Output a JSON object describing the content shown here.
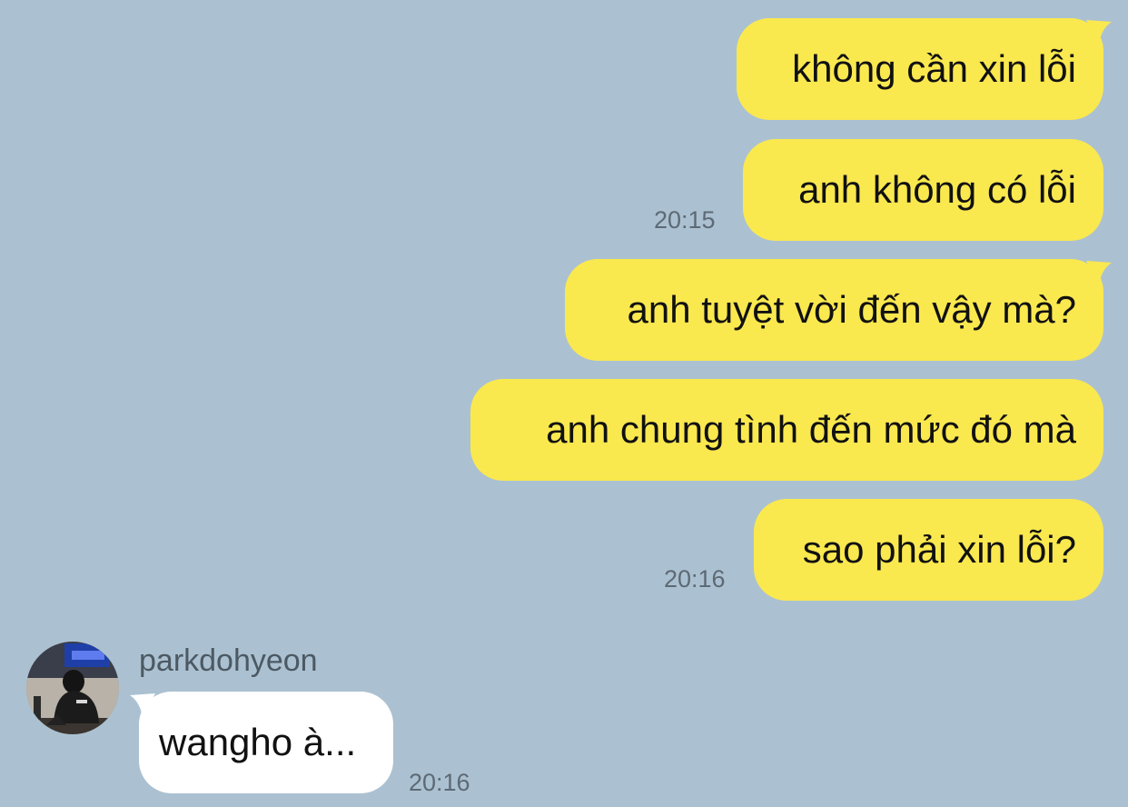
{
  "conversation": {
    "outgoing": [
      {
        "text": "không cần xin lỗi"
      },
      {
        "text": "anh không có lỗi",
        "time": "20:15"
      },
      {
        "text": "anh tuyệt vời đến vậy mà?"
      },
      {
        "text": "anh chung tình đến mức đó mà"
      },
      {
        "text": "sao phải xin lỗi?",
        "time": "20:16"
      }
    ],
    "incoming": {
      "sender_name": "parkdohyeon",
      "text": "wangho à...",
      "time": "20:16",
      "avatar_icon": "profile-photo"
    }
  },
  "colors": {
    "background": "#abc1d1",
    "outgoing_bubble": "#fae84f",
    "incoming_bubble": "#ffffff",
    "timestamp": "#5d6a75"
  }
}
